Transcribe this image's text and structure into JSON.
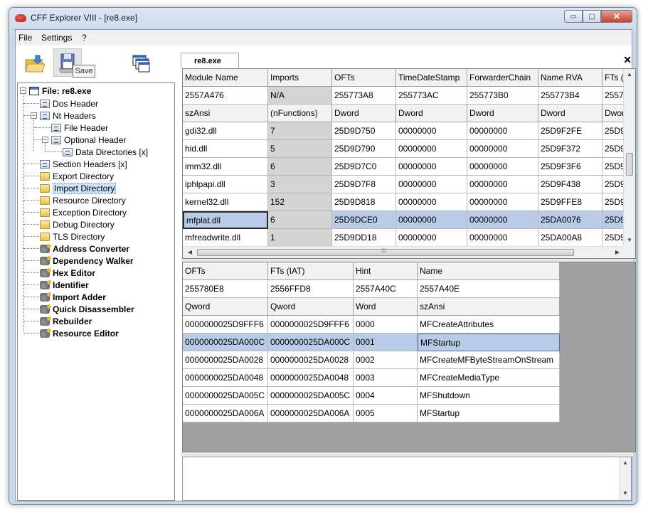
{
  "window": {
    "title": "CFF Explorer VIII - [re8.exe]",
    "minimize": "▭",
    "maximize": "▢",
    "close": "✕"
  },
  "menu": {
    "file": "File",
    "settings": "Settings",
    "help": "?"
  },
  "toolbar": {
    "tooltip": "Save",
    "open_icon": "folder-open-icon",
    "save_icon": "save-disk-icon",
    "windows_icon": "windows-icon"
  },
  "tree": {
    "root": "File: re8.exe",
    "items": [
      {
        "label": "Dos Header",
        "icon": "doc"
      },
      {
        "label": "Nt Headers",
        "icon": "doc",
        "expanded": true
      },
      {
        "label": "File Header",
        "icon": "doc"
      },
      {
        "label": "Optional Header",
        "icon": "doc",
        "expanded": true
      },
      {
        "label": "Data Directories [x]",
        "icon": "doc"
      },
      {
        "label": "Section Headers [x]",
        "icon": "doc"
      },
      {
        "label": "Export Directory",
        "icon": "folder"
      },
      {
        "label": "Import Directory",
        "icon": "folder",
        "selected": true
      },
      {
        "label": "Resource Directory",
        "icon": "folder"
      },
      {
        "label": "Exception Directory",
        "icon": "folder"
      },
      {
        "label": "Debug Directory",
        "icon": "folder"
      },
      {
        "label": "TLS Directory",
        "icon": "folder"
      },
      {
        "label": "Address Converter",
        "icon": "tool"
      },
      {
        "label": "Dependency Walker",
        "icon": "tool"
      },
      {
        "label": "Hex Editor",
        "icon": "tool"
      },
      {
        "label": "Identifier",
        "icon": "tool"
      },
      {
        "label": "Import Adder",
        "icon": "tool"
      },
      {
        "label": "Quick Disassembler",
        "icon": "tool"
      },
      {
        "label": "Rebuilder",
        "icon": "tool"
      },
      {
        "label": "Resource Editor",
        "icon": "tool"
      }
    ]
  },
  "tab": {
    "label": "re8.exe",
    "close": "✕"
  },
  "imports_table": {
    "columns": [
      "Module Name",
      "Imports",
      "OFTs",
      "TimeDateStamp",
      "ForwarderChain",
      "Name RVA",
      "FTs ("
    ],
    "offsets": [
      "2557A476",
      "N/A",
      "255773A8",
      "255773AC",
      "255773B0",
      "255773B4",
      "25577"
    ],
    "types": [
      "szAnsi",
      "(nFunctions)",
      "Dword",
      "Dword",
      "Dword",
      "Dword",
      "Dwor"
    ],
    "rows": [
      [
        "gdi32.dll",
        "7",
        "25D9D750",
        "00000000",
        "00000000",
        "25D9F2FE",
        "25D9"
      ],
      [
        "hid.dll",
        "5",
        "25D9D790",
        "00000000",
        "00000000",
        "25D9F372",
        "25D9"
      ],
      [
        "imm32.dll",
        "6",
        "25D9D7C0",
        "00000000",
        "00000000",
        "25D9F3F6",
        "25D9"
      ],
      [
        "iphlpapi.dll",
        "3",
        "25D9D7F8",
        "00000000",
        "00000000",
        "25D9F438",
        "25D9"
      ],
      [
        "kernel32.dll",
        "152",
        "25D9D818",
        "00000000",
        "00000000",
        "25D9FFE8",
        "25D9"
      ],
      [
        "mfplat.dll",
        "6",
        "25D9DCE0",
        "00000000",
        "00000000",
        "25DA0076",
        "25D9"
      ],
      [
        "mfreadwrite.dll",
        "1",
        "25D9DD18",
        "00000000",
        "00000000",
        "25DA00A8",
        "25D9"
      ]
    ],
    "selected_row": 5
  },
  "functions_table": {
    "columns": [
      "OFTs",
      "FTs (IAT)",
      "Hint",
      "Name"
    ],
    "offsets": [
      "255780E8",
      "2556FFD8",
      "2557A40C",
      "2557A40E"
    ],
    "types": [
      "Qword",
      "Qword",
      "Word",
      "szAnsi"
    ],
    "rows": [
      [
        "0000000025D9FFF6",
        "0000000025D9FFF6",
        "0000",
        "MFCreateAttributes"
      ],
      [
        "0000000025DA000C",
        "0000000025DA000C",
        "0001",
        "MFStartup"
      ],
      [
        "0000000025DA0028",
        "0000000025DA0028",
        "0002",
        "MFCreateMFByteStreamOnStream"
      ],
      [
        "0000000025DA0048",
        "0000000025DA0048",
        "0003",
        "MFCreateMediaType"
      ],
      [
        "0000000025DA005C",
        "0000000025DA005C",
        "0004",
        "MFShutdown"
      ],
      [
        "0000000025DA006A",
        "0000000025DA006A",
        "0005",
        "MFStartup"
      ]
    ],
    "selected_row": 1
  },
  "scroll": {
    "up": "▲",
    "down": "▼",
    "left": "◀",
    "right": "▶",
    "grip": "⁞⁞⁞"
  },
  "colors": {
    "selection": "#b8cce8",
    "tree_selection": "#cde3f8",
    "grid_gray": "#d4d4d4"
  }
}
